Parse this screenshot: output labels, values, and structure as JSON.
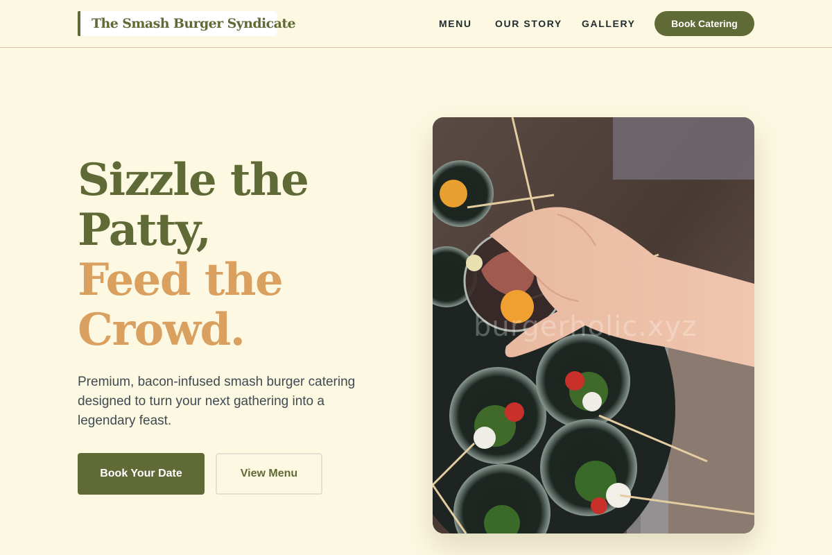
{
  "header": {
    "brand": "The Smash Burger Syndicate",
    "nav": [
      {
        "label": "MENU"
      },
      {
        "label": "OUR STORY"
      },
      {
        "label": "GALLERY"
      }
    ],
    "cta_label": "Book Catering"
  },
  "hero": {
    "headline_line1": "Sizzle the",
    "headline_line2": "Patty,",
    "headline_line3": "Feed the",
    "headline_line4": "Crowd.",
    "subtext": "Premium, bacon-infused smash burger catering designed to turn your next gathering into a legendary feast.",
    "primary_button": "Book Your Date",
    "secondary_button": "View Menu"
  },
  "photo": {
    "watermark": "burgerholic.xyz"
  },
  "colors": {
    "brand_green": "#5f6a36",
    "accent_tan": "#d9a060",
    "background": "#fdf8e1"
  }
}
